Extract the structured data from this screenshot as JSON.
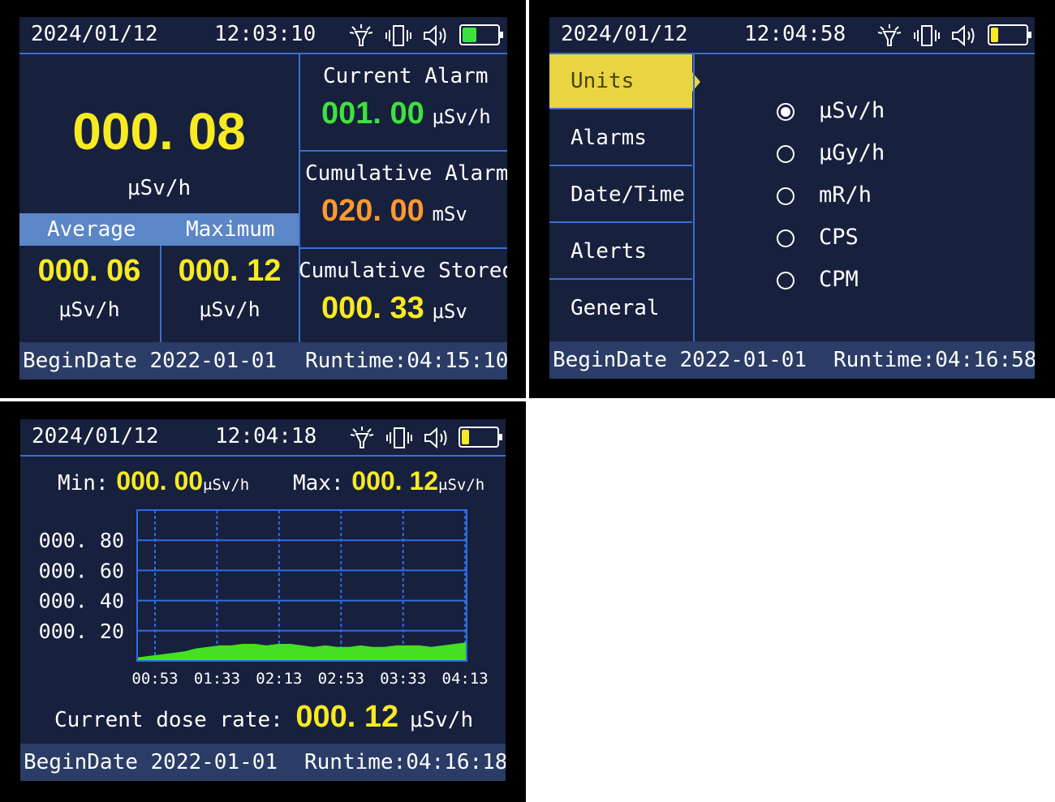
{
  "screen1": {
    "date": "2024/01/12",
    "time": "12:03:10",
    "main_value": "000. 08",
    "main_unit": "μSv/h",
    "average_label": "Average",
    "maximum_label": "Maximum",
    "average_value": "000. 06",
    "average_unit": "μSv/h",
    "maximum_value": "000. 12",
    "maximum_unit": "μSv/h",
    "current_alarm_label": "Current Alarm",
    "current_alarm_value": "001. 00",
    "current_alarm_unit": "μSv/h",
    "cumulative_alarm_label": "Cumulative Alarm",
    "cumulative_alarm_value": "020. 00",
    "cumulative_alarm_unit": "mSv",
    "cumulative_stored_label": "Cumulative Stored",
    "cumulative_stored_value": "000. 33",
    "cumulative_stored_unit": "μSv",
    "begin_date": "BeginDate 2022-01-01",
    "runtime": "Runtime:04:15:10",
    "battery_color": "#3ee23c"
  },
  "screen2": {
    "date": "2024/01/12",
    "time": "12:04:58",
    "menu": [
      "Units",
      "Alarms",
      "Date/Time",
      "Alerts",
      "General"
    ],
    "unit_options": [
      "μSv/h",
      "μGy/h",
      "mR/h",
      "CPS",
      "CPM"
    ],
    "selected_unit": "μSv/h",
    "begin_date": "BeginDate 2022-01-01",
    "runtime": "Runtime:04:16:58",
    "battery_color": "#f7ea22"
  },
  "screen3": {
    "date": "2024/01/12",
    "time": "12:04:18",
    "min_label": "Min:",
    "min_value": "000. 00",
    "min_unit": "μSv/h",
    "max_label": "Max:",
    "max_value": "000. 12",
    "max_unit": "μSv/h",
    "current_label": "Current dose rate:",
    "current_value": "000. 12",
    "current_unit": "μSv/h",
    "begin_date": "BeginDate 2022-01-01",
    "runtime": "Runtime:04:16:18",
    "battery_color": "#f7ea22"
  },
  "chart_data": {
    "type": "area",
    "y_ticks": [
      "000. 80",
      "000. 60",
      "000. 40",
      "000. 20"
    ],
    "x_ticks": [
      "00:53",
      "01:33",
      "02:13",
      "02:53",
      "03:33",
      "04:13"
    ],
    "ylim": [
      0,
      1.0
    ],
    "grid": true,
    "color": "#44e021",
    "values": [
      0.02,
      0.03,
      0.04,
      0.05,
      0.06,
      0.08,
      0.09,
      0.1,
      0.1,
      0.11,
      0.11,
      0.1,
      0.11,
      0.11,
      0.1,
      0.09,
      0.1,
      0.09,
      0.09,
      0.1,
      0.09,
      0.09,
      0.1,
      0.1,
      0.1,
      0.09,
      0.1,
      0.11,
      0.12
    ]
  }
}
